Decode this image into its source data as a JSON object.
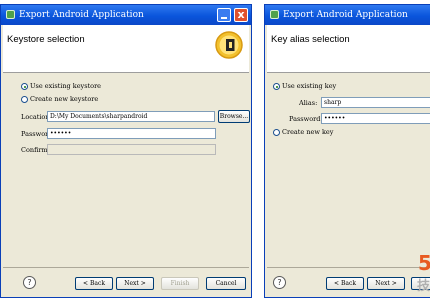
{
  "left": {
    "title": "Export Android Application",
    "header_title": "Keystore selection",
    "use_existing_keystore": "Use existing keystore",
    "create_new_keystore": "Create new keystore",
    "location_label": "Location:",
    "location_value": "D:\\My Documents\\sharpandroid",
    "browse_button": "Browse...",
    "password_label": "Password:",
    "password_value": "••••••",
    "confirm_label": "Confirm:",
    "confirm_value": "",
    "help_symbol": "?",
    "back_button": "< Back",
    "next_button": "Next >",
    "finish_button": "Finish",
    "cancel_button": "Cancel",
    "close_glyph": "x"
  },
  "right": {
    "title": "Export Android Application",
    "header_title": "Key alias selection",
    "use_existing_key": "Use existing key",
    "alias_label": "Alias:",
    "alias_value": "sharp",
    "password_label": "Password:",
    "password_value": "••••••",
    "create_new_key": "Create new key",
    "help_symbol": "?",
    "back_button": "< Back",
    "next_button": "Next >",
    "watermark_number": "5",
    "watermark_char": "技"
  },
  "colors": {
    "title_bar": "#0a55dc",
    "dialog_bg": "#ece9d8",
    "close_button": "#e0522e"
  }
}
